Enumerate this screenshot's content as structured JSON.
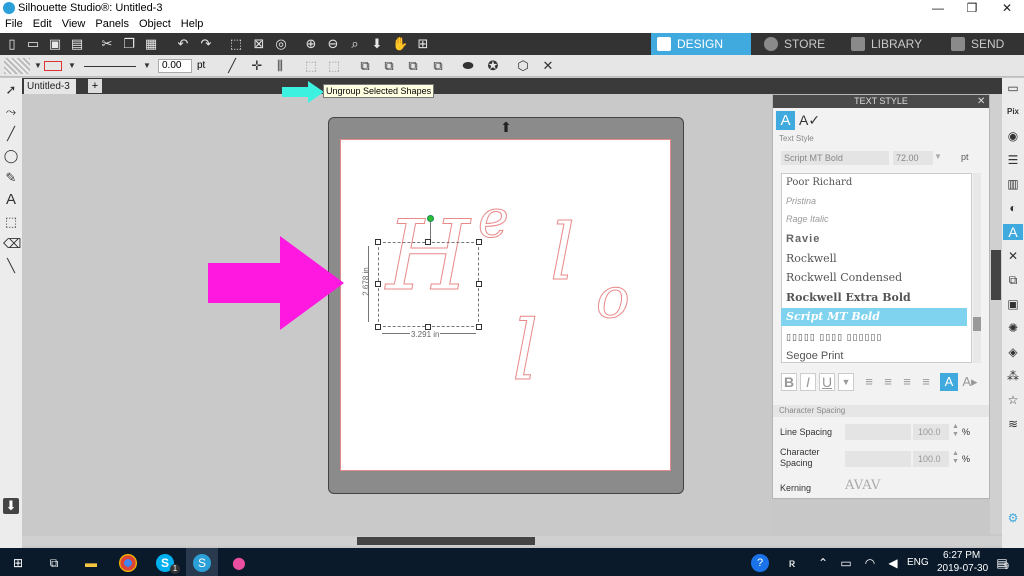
{
  "window": {
    "title": "Silhouette Studio®: Untitled-3",
    "min": "—",
    "max": "❐",
    "close": "✕"
  },
  "menu": [
    "File",
    "Edit",
    "View",
    "Panels",
    "Object",
    "Help"
  ],
  "nav_tabs": [
    {
      "label": "DESIGN",
      "active": true
    },
    {
      "label": "STORE",
      "active": false
    },
    {
      "label": "LIBRARY",
      "active": false
    },
    {
      "label": "SEND",
      "active": false
    }
  ],
  "line_weight": {
    "value": "0.00",
    "unit": "pt"
  },
  "document_tab": {
    "label": "Untitled-3",
    "add": "+"
  },
  "tooltip": "Ungroup Selected Shapes",
  "selection": {
    "height": "2.678 in",
    "width": "3.291 in"
  },
  "text_style_panel": {
    "title": "TEXT STYLE",
    "section_label": "Text Style",
    "font_field": "Script MT Bold",
    "size_field": "72.00",
    "size_unit": "pt",
    "fonts": [
      {
        "name": "Poor Richard",
        "selected": false
      },
      {
        "name": "Pristina",
        "selected": false
      },
      {
        "name": "Rage Italic",
        "selected": false
      },
      {
        "name": "Ravie",
        "selected": false
      },
      {
        "name": "Rockwell",
        "selected": false
      },
      {
        "name": "Rockwell Condensed",
        "selected": false
      },
      {
        "name": "Rockwell Extra Bold",
        "selected": false
      },
      {
        "name": "Script MT Bold",
        "selected": true
      },
      {
        "name": "▯▯▯▯▯ ▯▯▯▯ ▯▯▯▯▯▯",
        "selected": false
      },
      {
        "name": "Segoe Print",
        "selected": false
      }
    ],
    "format_buttons": {
      "bold": "B",
      "italic": "I",
      "underline": "U"
    },
    "character_spacing_label": "Character Spacing",
    "line_spacing": {
      "label": "Line Spacing",
      "value": "100.0",
      "unit": "%"
    },
    "char_spacing": {
      "label": "Character Spacing",
      "value": "100.0",
      "unit": "%"
    },
    "kerning": {
      "label": "Kerning",
      "value": "AVAV"
    }
  },
  "letters": [
    "H",
    "e",
    "l",
    "l",
    "o"
  ],
  "taskbar": {
    "time": "6:27 PM",
    "date": "2019-07-30",
    "lang": "ENG",
    "notifications": "9",
    "skype_badge": "1"
  },
  "colors": {
    "accent": "#40a9de",
    "arrow_magenta": "#ff19e0",
    "arrow_cyan": "#3cf1e0",
    "outline": "#e88a8a"
  }
}
